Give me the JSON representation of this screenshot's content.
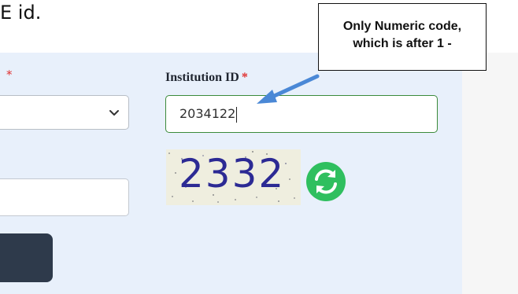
{
  "intro": {
    "text": "E id."
  },
  "form": {
    "left_required_marker": "*",
    "institution_label": "Institution ID",
    "institution_required_marker": "*",
    "institution_value": "2034122",
    "captcha_text": "2332"
  },
  "annotation": {
    "line1": "Only Numeric code,",
    "line2": "which is after 1 -"
  },
  "icons": {
    "select_chevron": "chevron-down-icon",
    "refresh": "refresh-icon",
    "arrow": "arrow-icon"
  },
  "colors": {
    "panel": "#e8f0fb",
    "required": "#e0302f",
    "input_focus_border": "#3b8a3a",
    "refresh": "#2fbf5f",
    "button": "#2e3a4b",
    "arrow": "#4a88d6"
  }
}
